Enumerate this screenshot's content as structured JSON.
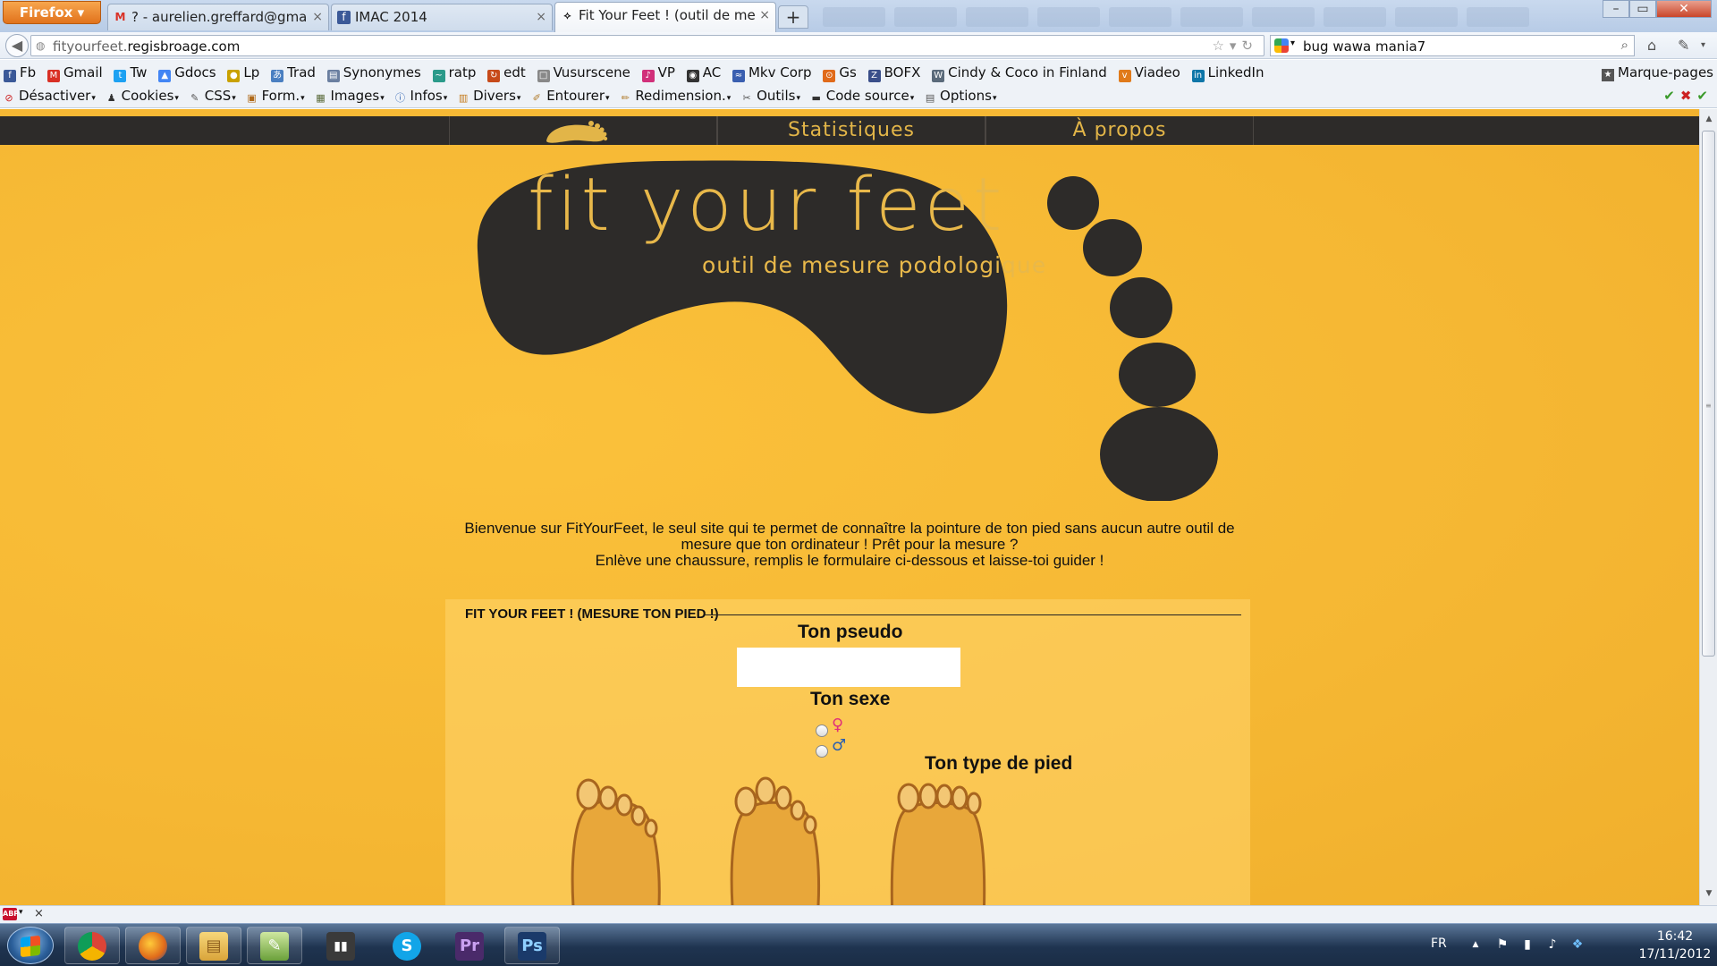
{
  "browser": {
    "menu_button": "Firefox",
    "tabs": [
      {
        "title": "? - aurelien.greffard@gmail.c...",
        "favicon": "gmail-icon"
      },
      {
        "title": "IMAC 2014",
        "favicon": "facebook-icon"
      },
      {
        "title": "Fit Your Feet ! (outil de mesur...",
        "favicon": "footprint-icon",
        "active": true
      }
    ],
    "new_tab": "+",
    "url_prefix": "fityourfeet.",
    "url_domain": "regisbroage.com",
    "search_query": "bug wawa mania7"
  },
  "bookmarks": {
    "items": [
      {
        "label": "Fb",
        "icon": "facebook-icon",
        "color": "#3b5998"
      },
      {
        "label": "Gmail",
        "icon": "gmail-icon",
        "color": "#d93025"
      },
      {
        "label": "Tw",
        "icon": "twitter-icon",
        "color": "#1da1f2"
      },
      {
        "label": "Gdocs",
        "icon": "gdocs-icon",
        "color": "#4285f4"
      },
      {
        "label": "Lp",
        "icon": "lp-icon",
        "color": "#c9a100"
      },
      {
        "label": "Trad",
        "icon": "translate-icon",
        "color": "#4a7fc1"
      },
      {
        "label": "Synonymes",
        "icon": "synonymes-icon",
        "color": "#6a7fa0"
      },
      {
        "label": "ratp",
        "icon": "ratp-icon",
        "color": "#2a9a8a"
      },
      {
        "label": "edt",
        "icon": "edt-icon",
        "color": "#c74a1a"
      },
      {
        "label": "Vusurscene",
        "icon": "vusurscene-icon",
        "color": "#888888"
      },
      {
        "label": "VP",
        "icon": "vp-icon",
        "color": "#d1307a"
      },
      {
        "label": "AC",
        "icon": "ac-icon",
        "color": "#333333"
      },
      {
        "label": "Mkv Corp",
        "icon": "mkv-icon",
        "color": "#3a5fb0"
      },
      {
        "label": "Gs",
        "icon": "gs-icon",
        "color": "#e06a1a"
      },
      {
        "label": "BOFX",
        "icon": "bofx-icon",
        "color": "#3a4f8a"
      },
      {
        "label": "Cindy & Coco in Finland",
        "icon": "wordpress-icon",
        "color": "#5a6a7a"
      },
      {
        "label": "Viadeo",
        "icon": "viadeo-icon",
        "color": "#e07a1a"
      },
      {
        "label": "LinkedIn",
        "icon": "linkedin-icon",
        "color": "#0e76a8"
      }
    ],
    "right_label": "Marque-pages"
  },
  "devbar": {
    "items": [
      {
        "label": "Désactiver",
        "icon": "disable-icon",
        "color": "#cc2222"
      },
      {
        "label": "Cookies",
        "icon": "cookies-icon",
        "color": "#333333"
      },
      {
        "label": "CSS",
        "icon": "css-icon",
        "color": "#555555"
      },
      {
        "label": "Form.",
        "icon": "form-icon",
        "color": "#b06a1a"
      },
      {
        "label": "Images",
        "icon": "images-icon",
        "color": "#5a6a3a"
      },
      {
        "label": "Infos",
        "icon": "info-icon",
        "color": "#2a5fb0"
      },
      {
        "label": "Divers",
        "icon": "divers-icon",
        "color": "#c47a1a"
      },
      {
        "label": "Entourer",
        "icon": "outline-icon",
        "color": "#b07a2a"
      },
      {
        "label": "Redimension.",
        "icon": "resize-icon",
        "color": "#b07a2a"
      },
      {
        "label": "Outils",
        "icon": "tools-icon",
        "color": "#555555"
      },
      {
        "label": "Code source",
        "icon": "source-icon",
        "color": "#333333"
      },
      {
        "label": "Options",
        "icon": "options-icon",
        "color": "#555555"
      }
    ]
  },
  "site": {
    "nav": {
      "home_icon": "footprint-logo-icon",
      "stats": "Statistiques",
      "about": "À propos"
    },
    "logo_title": "fit your feet",
    "logo_subtitle": "outil de mesure podologique",
    "intro_line1": "Bienvenue sur FitYourFeet, le seul site qui te permet de connaître la pointure de ton pied sans aucun autre outil de",
    "intro_line2": "mesure que ton ordinateur ! Prêt pour la mesure ?",
    "intro_line3": "Enlève une chaussure, remplis le formulaire ci-dessous et laisse-toi guider !",
    "form": {
      "legend": "FIT YOUR FEET ! (MESURE TON PIED !)",
      "pseudo_label": "Ton pseudo",
      "pseudo_value": "",
      "sex_label": "Ton sexe",
      "sex_female_icon": "female-icon",
      "sex_male_icon": "male-icon",
      "foot_type_label": "Ton type de pied",
      "foot_types": [
        "foot-type-egyptian",
        "foot-type-greek",
        "foot-type-square"
      ]
    },
    "colors": {
      "background": "#f5b733",
      "dark": "#2d2b29",
      "accent": "#e2b548"
    }
  },
  "taskbar": {
    "apps": [
      {
        "name": "chrome",
        "glyph": "●",
        "color": "#3a8a3a"
      },
      {
        "name": "firefox",
        "glyph": "●",
        "color": "#e06a1a"
      },
      {
        "name": "explorer",
        "glyph": "▤",
        "color": "#d9a43a"
      },
      {
        "name": "frogger",
        "glyph": "✎",
        "color": "#6aa03a"
      },
      {
        "name": "speakers",
        "glyph": "▮▮",
        "color": "#444444"
      },
      {
        "name": "skype",
        "glyph": "S",
        "color": "#12a5e8"
      },
      {
        "name": "premiere",
        "glyph": "Pr",
        "color": "#4a2a6a"
      },
      {
        "name": "photoshop",
        "glyph": "Ps",
        "color": "#1a3a6a"
      }
    ],
    "language": "FR",
    "time": "16:42",
    "date": "17/11/2012"
  }
}
